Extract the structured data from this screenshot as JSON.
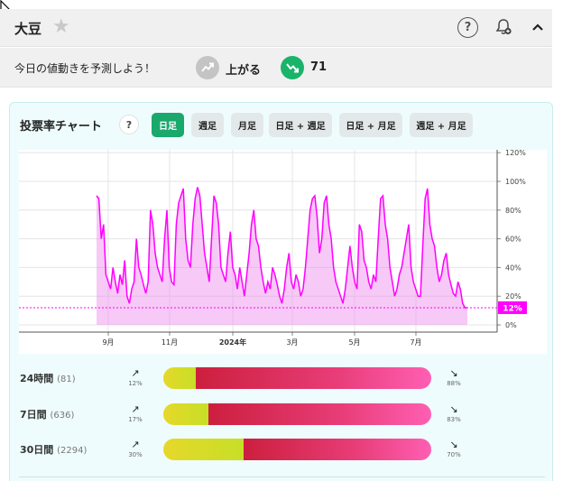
{
  "header": {
    "title": "大豆",
    "help_label": "?"
  },
  "prediction": {
    "prompt": "今日の値動きを予測しよう！",
    "up_label": "上がる",
    "down_count": "71"
  },
  "chart_panel": {
    "title": "投票率チャート",
    "help_label": "?",
    "tabs": [
      "日足",
      "週足",
      "月足",
      "日足 + 週足",
      "日足 + 月足",
      "週足 + 月足"
    ],
    "active_tab": "日足"
  },
  "chart_data": {
    "type": "area",
    "title": "",
    "xlabel": "",
    "ylabel": "",
    "ylim": [
      -5,
      122
    ],
    "y_ticks": [
      "120%",
      "100%",
      "80%",
      "60%",
      "40%",
      "20%",
      "0%"
    ],
    "x_ticks": [
      "9月",
      "11月",
      "2024年",
      "3月",
      "5月",
      "7月"
    ],
    "current_value_label": "12%",
    "current_value": 12,
    "colors": {
      "series": "#ff00ff",
      "fill": "#ee88ee",
      "current_badge": "#ff00ff"
    },
    "series": [
      {
        "values": [
          90,
          88,
          60,
          70,
          35,
          30,
          25,
          40,
          30,
          22,
          35,
          28,
          45,
          20,
          15,
          25,
          30,
          60,
          40,
          35,
          28,
          22,
          30,
          80,
          70,
          50,
          40,
          35,
          30,
          60,
          80,
          40,
          30,
          28,
          70,
          85,
          90,
          95,
          60,
          45,
          40,
          70,
          88,
          96,
          90,
          70,
          50,
          40,
          30,
          60,
          90,
          85,
          70,
          40,
          35,
          30,
          50,
          65,
          40,
          35,
          25,
          40,
          30,
          20,
          35,
          50,
          70,
          80,
          60,
          55,
          40,
          30,
          22,
          30,
          25,
          40,
          35,
          28,
          20,
          15,
          25,
          40,
          50,
          30,
          25,
          35,
          30,
          20,
          25,
          40,
          60,
          80,
          88,
          90,
          75,
          50,
          60,
          85,
          90,
          70,
          60,
          40,
          30,
          25,
          20,
          15,
          25,
          40,
          55,
          40,
          30,
          25,
          70,
          65,
          45,
          40,
          30,
          25,
          35,
          30,
          60,
          88,
          90,
          70,
          60,
          40,
          30,
          20,
          25,
          35,
          40,
          50,
          60,
          70,
          40,
          30,
          25,
          20,
          20,
          55,
          88,
          95,
          70,
          60,
          55,
          40,
          30,
          35,
          45,
          50,
          35,
          28,
          22,
          20,
          30,
          25,
          15,
          12,
          12
        ]
      }
    ]
  },
  "stats": [
    {
      "period": "24時間",
      "count": "(81)",
      "up_pct": "12%",
      "down_pct": "88%",
      "up_value": 12
    },
    {
      "period": "7日間",
      "count": "(636)",
      "up_pct": "17%",
      "down_pct": "83%",
      "up_value": 17
    },
    {
      "period": "30日間",
      "count": "(2294)",
      "up_pct": "30%",
      "down_pct": "70%",
      "up_value": 30
    }
  ]
}
